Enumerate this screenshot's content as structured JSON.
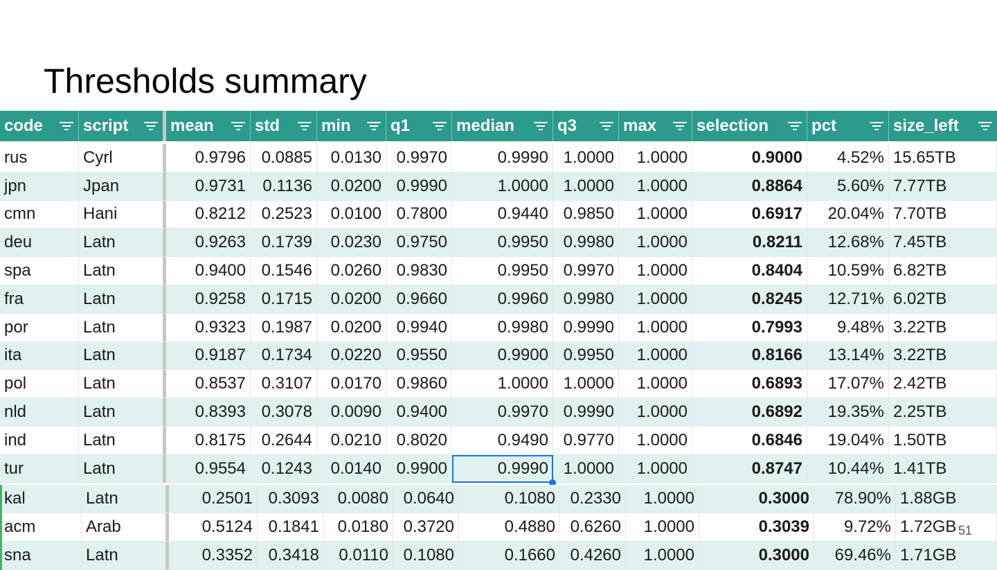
{
  "title": "Thresholds summary",
  "columns": [
    "code",
    "script",
    "mean",
    "std",
    "min",
    "q1",
    "median",
    "q3",
    "max",
    "selection",
    "pct",
    "size_left"
  ],
  "rows": [
    [
      "rus",
      "Cyrl",
      "0.9796",
      "0.0885",
      "0.0130",
      "0.9970",
      "0.9990",
      "1.0000",
      "1.0000",
      "0.9000",
      "4.52%",
      "15.65TB"
    ],
    [
      "jpn",
      "Jpan",
      "0.9731",
      "0.1136",
      "0.0200",
      "0.9990",
      "1.0000",
      "1.0000",
      "1.0000",
      "0.8864",
      "5.60%",
      "7.77TB"
    ],
    [
      "cmn",
      "Hani",
      "0.8212",
      "0.2523",
      "0.0100",
      "0.7800",
      "0.9440",
      "0.9850",
      "1.0000",
      "0.6917",
      "20.04%",
      "7.70TB"
    ],
    [
      "deu",
      "Latn",
      "0.9263",
      "0.1739",
      "0.0230",
      "0.9750",
      "0.9950",
      "0.9980",
      "1.0000",
      "0.8211",
      "12.68%",
      "7.45TB"
    ],
    [
      "spa",
      "Latn",
      "0.9400",
      "0.1546",
      "0.0260",
      "0.9830",
      "0.9950",
      "0.9970",
      "1.0000",
      "0.8404",
      "10.59%",
      "6.82TB"
    ],
    [
      "fra",
      "Latn",
      "0.9258",
      "0.1715",
      "0.0200",
      "0.9660",
      "0.9960",
      "0.9980",
      "1.0000",
      "0.8245",
      "12.71%",
      "6.02TB"
    ],
    [
      "por",
      "Latn",
      "0.9323",
      "0.1987",
      "0.0200",
      "0.9940",
      "0.9980",
      "0.9990",
      "1.0000",
      "0.7993",
      "9.48%",
      "3.22TB"
    ],
    [
      "ita",
      "Latn",
      "0.9187",
      "0.1734",
      "0.0220",
      "0.9550",
      "0.9900",
      "0.9950",
      "1.0000",
      "0.8166",
      "13.14%",
      "3.22TB"
    ],
    [
      "pol",
      "Latn",
      "0.8537",
      "0.3107",
      "0.0170",
      "0.9860",
      "1.0000",
      "1.0000",
      "1.0000",
      "0.6893",
      "17.07%",
      "2.42TB"
    ],
    [
      "nld",
      "Latn",
      "0.8393",
      "0.3078",
      "0.0090",
      "0.9400",
      "0.9970",
      "0.9990",
      "1.0000",
      "0.6892",
      "19.35%",
      "2.25TB"
    ],
    [
      "ind",
      "Latn",
      "0.8175",
      "0.2644",
      "0.0210",
      "0.8020",
      "0.9490",
      "0.9770",
      "1.0000",
      "0.6846",
      "19.04%",
      "1.50TB"
    ],
    [
      "tur",
      "Latn",
      "0.9554",
      "0.1243",
      "0.0140",
      "0.9900",
      "0.9990",
      "1.0000",
      "1.0000",
      "0.8747",
      "10.44%",
      "1.41TB"
    ]
  ],
  "lower_rows": [
    [
      "kal",
      "Latn",
      "0.2501",
      "0.3093",
      "0.0080",
      "0.0640",
      "0.1080",
      "0.2330",
      "1.0000",
      "0.3000",
      "78.90%",
      "1.88GB"
    ],
    [
      "acm",
      "Arab",
      "0.5124",
      "0.1841",
      "0.0180",
      "0.3720",
      "0.4880",
      "0.6260",
      "1.0000",
      "0.3039",
      "9.72%",
      "1.72GB"
    ],
    [
      "sna",
      "Latn",
      "0.3352",
      "0.3418",
      "0.0110",
      "0.1080",
      "0.1660",
      "0.4260",
      "1.0000",
      "0.3000",
      "69.46%",
      "1.71GB"
    ]
  ],
  "page_number": "51"
}
